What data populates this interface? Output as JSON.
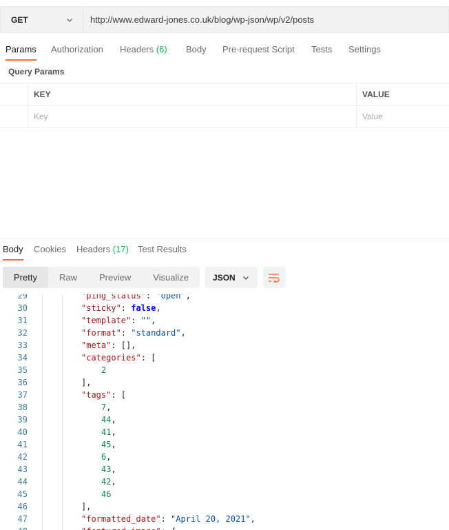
{
  "request": {
    "method": "GET",
    "url": "http://www.edward-jones.co.uk/blog/wp-json/wp/v2/posts"
  },
  "request_tabs": [
    {
      "label": "Params",
      "count": "",
      "active": true
    },
    {
      "label": "Authorization",
      "count": ""
    },
    {
      "label": "Headers",
      "count": "(6)"
    },
    {
      "label": "Body",
      "count": ""
    },
    {
      "label": "Pre-request Script",
      "count": ""
    },
    {
      "label": "Tests",
      "count": ""
    },
    {
      "label": "Settings",
      "count": ""
    }
  ],
  "query_params": {
    "title": "Query Params",
    "headers": {
      "key": "KEY",
      "value": "VALUE"
    },
    "placeholders": {
      "key": "Key",
      "value": "Value"
    }
  },
  "response_tabs": [
    {
      "label": "Body",
      "count": "",
      "active": true
    },
    {
      "label": "Cookies",
      "count": ""
    },
    {
      "label": "Headers",
      "count": "(17)"
    },
    {
      "label": "Test Results",
      "count": ""
    }
  ],
  "view_modes": [
    "Pretty",
    "Raw",
    "Preview",
    "Visualize"
  ],
  "active_view": "Pretty",
  "format": "JSON",
  "colors": {
    "accent": "#ff6c37",
    "count": "#0cbb52"
  },
  "code_lines": [
    {
      "n": "29",
      "indent": 2,
      "parts": [
        [
          "k",
          "\"ping_status\""
        ],
        [
          "p",
          ": "
        ],
        [
          "s",
          "\"open\""
        ],
        [
          "p",
          ","
        ]
      ]
    },
    {
      "n": "30",
      "indent": 2,
      "parts": [
        [
          "k",
          "\"sticky\""
        ],
        [
          "p",
          ": "
        ],
        [
          "b",
          "false"
        ],
        [
          "p",
          ","
        ]
      ]
    },
    {
      "n": "31",
      "indent": 2,
      "parts": [
        [
          "k",
          "\"template\""
        ],
        [
          "p",
          ": "
        ],
        [
          "s",
          "\"\""
        ],
        [
          "p",
          ","
        ]
      ]
    },
    {
      "n": "32",
      "indent": 2,
      "parts": [
        [
          "k",
          "\"format\""
        ],
        [
          "p",
          ": "
        ],
        [
          "s",
          "\"standard\""
        ],
        [
          "p",
          ","
        ]
      ]
    },
    {
      "n": "33",
      "indent": 2,
      "parts": [
        [
          "k",
          "\"meta\""
        ],
        [
          "p",
          ": [],"
        ]
      ]
    },
    {
      "n": "34",
      "indent": 2,
      "parts": [
        [
          "k",
          "\"categories\""
        ],
        [
          "p",
          ": ["
        ]
      ]
    },
    {
      "n": "35",
      "indent": 3,
      "parts": [
        [
          "n",
          "2"
        ]
      ]
    },
    {
      "n": "36",
      "indent": 2,
      "parts": [
        [
          "p",
          "],"
        ]
      ]
    },
    {
      "n": "37",
      "indent": 2,
      "parts": [
        [
          "k",
          "\"tags\""
        ],
        [
          "p",
          ": ["
        ]
      ]
    },
    {
      "n": "38",
      "indent": 3,
      "parts": [
        [
          "n",
          "7"
        ],
        [
          "p",
          ","
        ]
      ]
    },
    {
      "n": "39",
      "indent": 3,
      "parts": [
        [
          "n",
          "44"
        ],
        [
          "p",
          ","
        ]
      ]
    },
    {
      "n": "40",
      "indent": 3,
      "parts": [
        [
          "n",
          "41"
        ],
        [
          "p",
          ","
        ]
      ]
    },
    {
      "n": "41",
      "indent": 3,
      "parts": [
        [
          "n",
          "45"
        ],
        [
          "p",
          ","
        ]
      ]
    },
    {
      "n": "42",
      "indent": 3,
      "parts": [
        [
          "n",
          "6"
        ],
        [
          "p",
          ","
        ]
      ]
    },
    {
      "n": "43",
      "indent": 3,
      "parts": [
        [
          "n",
          "43"
        ],
        [
          "p",
          ","
        ]
      ]
    },
    {
      "n": "44",
      "indent": 3,
      "parts": [
        [
          "n",
          "42"
        ],
        [
          "p",
          ","
        ]
      ]
    },
    {
      "n": "45",
      "indent": 3,
      "parts": [
        [
          "n",
          "46"
        ]
      ]
    },
    {
      "n": "46",
      "indent": 2,
      "parts": [
        [
          "p",
          "],"
        ]
      ]
    },
    {
      "n": "47",
      "indent": 2,
      "parts": [
        [
          "k",
          "\"formatted_date\""
        ],
        [
          "p",
          ": "
        ],
        [
          "s",
          "\"April 20, 2021\""
        ],
        [
          "p",
          ","
        ]
      ]
    },
    {
      "n": "48",
      "indent": 2,
      "parts": [
        [
          "k",
          "\"featured_image\""
        ],
        [
          "p",
          ": {"
        ]
      ]
    }
  ]
}
